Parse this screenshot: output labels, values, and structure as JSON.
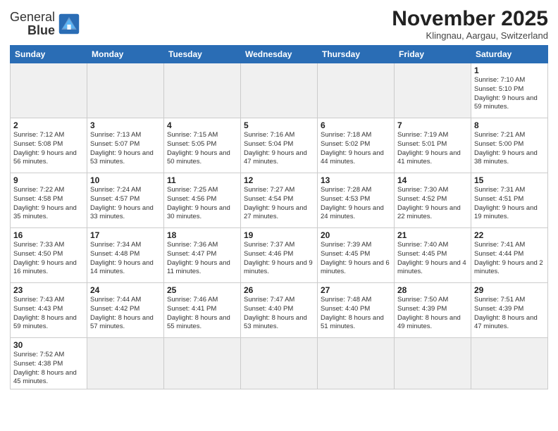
{
  "logo": {
    "text_general": "General",
    "text_blue": "Blue"
  },
  "title": "November 2025",
  "subtitle": "Klingnau, Aargau, Switzerland",
  "weekdays": [
    "Sunday",
    "Monday",
    "Tuesday",
    "Wednesday",
    "Thursday",
    "Friday",
    "Saturday"
  ],
  "weeks": [
    [
      {
        "day": "",
        "empty": true
      },
      {
        "day": "",
        "empty": true
      },
      {
        "day": "",
        "empty": true
      },
      {
        "day": "",
        "empty": true
      },
      {
        "day": "",
        "empty": true
      },
      {
        "day": "",
        "empty": true
      },
      {
        "day": "1",
        "info": "Sunrise: 7:10 AM\nSunset: 5:10 PM\nDaylight: 9 hours and 59 minutes."
      }
    ],
    [
      {
        "day": "2",
        "info": "Sunrise: 7:12 AM\nSunset: 5:08 PM\nDaylight: 9 hours and 56 minutes."
      },
      {
        "day": "3",
        "info": "Sunrise: 7:13 AM\nSunset: 5:07 PM\nDaylight: 9 hours and 53 minutes."
      },
      {
        "day": "4",
        "info": "Sunrise: 7:15 AM\nSunset: 5:05 PM\nDaylight: 9 hours and 50 minutes."
      },
      {
        "day": "5",
        "info": "Sunrise: 7:16 AM\nSunset: 5:04 PM\nDaylight: 9 hours and 47 minutes."
      },
      {
        "day": "6",
        "info": "Sunrise: 7:18 AM\nSunset: 5:02 PM\nDaylight: 9 hours and 44 minutes."
      },
      {
        "day": "7",
        "info": "Sunrise: 7:19 AM\nSunset: 5:01 PM\nDaylight: 9 hours and 41 minutes."
      },
      {
        "day": "8",
        "info": "Sunrise: 7:21 AM\nSunset: 5:00 PM\nDaylight: 9 hours and 38 minutes."
      }
    ],
    [
      {
        "day": "9",
        "info": "Sunrise: 7:22 AM\nSunset: 4:58 PM\nDaylight: 9 hours and 35 minutes."
      },
      {
        "day": "10",
        "info": "Sunrise: 7:24 AM\nSunset: 4:57 PM\nDaylight: 9 hours and 33 minutes."
      },
      {
        "day": "11",
        "info": "Sunrise: 7:25 AM\nSunset: 4:56 PM\nDaylight: 9 hours and 30 minutes."
      },
      {
        "day": "12",
        "info": "Sunrise: 7:27 AM\nSunset: 4:54 PM\nDaylight: 9 hours and 27 minutes."
      },
      {
        "day": "13",
        "info": "Sunrise: 7:28 AM\nSunset: 4:53 PM\nDaylight: 9 hours and 24 minutes."
      },
      {
        "day": "14",
        "info": "Sunrise: 7:30 AM\nSunset: 4:52 PM\nDaylight: 9 hours and 22 minutes."
      },
      {
        "day": "15",
        "info": "Sunrise: 7:31 AM\nSunset: 4:51 PM\nDaylight: 9 hours and 19 minutes."
      }
    ],
    [
      {
        "day": "16",
        "info": "Sunrise: 7:33 AM\nSunset: 4:50 PM\nDaylight: 9 hours and 16 minutes."
      },
      {
        "day": "17",
        "info": "Sunrise: 7:34 AM\nSunset: 4:48 PM\nDaylight: 9 hours and 14 minutes."
      },
      {
        "day": "18",
        "info": "Sunrise: 7:36 AM\nSunset: 4:47 PM\nDaylight: 9 hours and 11 minutes."
      },
      {
        "day": "19",
        "info": "Sunrise: 7:37 AM\nSunset: 4:46 PM\nDaylight: 9 hours and 9 minutes."
      },
      {
        "day": "20",
        "info": "Sunrise: 7:39 AM\nSunset: 4:45 PM\nDaylight: 9 hours and 6 minutes."
      },
      {
        "day": "21",
        "info": "Sunrise: 7:40 AM\nSunset: 4:45 PM\nDaylight: 9 hours and 4 minutes."
      },
      {
        "day": "22",
        "info": "Sunrise: 7:41 AM\nSunset: 4:44 PM\nDaylight: 9 hours and 2 minutes."
      }
    ],
    [
      {
        "day": "23",
        "info": "Sunrise: 7:43 AM\nSunset: 4:43 PM\nDaylight: 8 hours and 59 minutes."
      },
      {
        "day": "24",
        "info": "Sunrise: 7:44 AM\nSunset: 4:42 PM\nDaylight: 8 hours and 57 minutes."
      },
      {
        "day": "25",
        "info": "Sunrise: 7:46 AM\nSunset: 4:41 PM\nDaylight: 8 hours and 55 minutes."
      },
      {
        "day": "26",
        "info": "Sunrise: 7:47 AM\nSunset: 4:40 PM\nDaylight: 8 hours and 53 minutes."
      },
      {
        "day": "27",
        "info": "Sunrise: 7:48 AM\nSunset: 4:40 PM\nDaylight: 8 hours and 51 minutes."
      },
      {
        "day": "28",
        "info": "Sunrise: 7:50 AM\nSunset: 4:39 PM\nDaylight: 8 hours and 49 minutes."
      },
      {
        "day": "29",
        "info": "Sunrise: 7:51 AM\nSunset: 4:39 PM\nDaylight: 8 hours and 47 minutes."
      }
    ],
    [
      {
        "day": "30",
        "info": "Sunrise: 7:52 AM\nSunset: 4:38 PM\nDaylight: 8 hours and 45 minutes.",
        "last": true
      },
      {
        "day": "",
        "empty": true,
        "last": true
      },
      {
        "day": "",
        "empty": true,
        "last": true
      },
      {
        "day": "",
        "empty": true,
        "last": true
      },
      {
        "day": "",
        "empty": true,
        "last": true
      },
      {
        "day": "",
        "empty": true,
        "last": true
      },
      {
        "day": "",
        "empty": true,
        "last": true
      }
    ]
  ]
}
